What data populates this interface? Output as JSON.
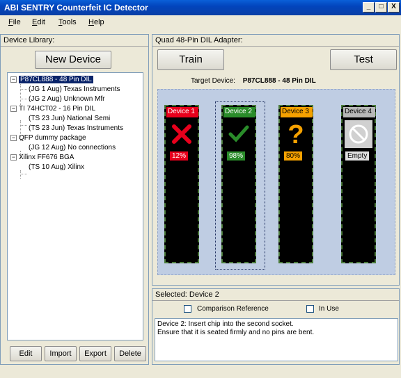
{
  "window": {
    "title": "ABI SENTRY Counterfeit IC Detector",
    "buttons": [
      "_",
      "□",
      "X"
    ]
  },
  "menu": [
    {
      "label": "File",
      "accel": "F",
      "rest": "ile"
    },
    {
      "label": "Edit",
      "accel": "E",
      "rest": "dit"
    },
    {
      "label": "Tools",
      "accel": "T",
      "rest": "ools"
    },
    {
      "label": "Help",
      "accel": "H",
      "rest": "elp"
    }
  ],
  "library": {
    "header": "Device Library:",
    "new_device": "New Device",
    "tree": [
      {
        "label": "P87CL888 - 48 Pin DIL",
        "selected": true
      },
      {
        "label": "(JG 1 Aug) Texas Instruments"
      },
      {
        "label": "(JG 2 Aug) Unknown Mfr"
      },
      {
        "label": "TI 74HCT02 - 16 Pin DIL"
      },
      {
        "label": "(TS 23 Jun) National Semi"
      },
      {
        "label": "(TS 23 Jun) Texas Instruments"
      },
      {
        "label": "QFP dummy package"
      },
      {
        "label": "(JG 12 Aug) No connections"
      },
      {
        "label": "Xilinx FF676 BGA"
      },
      {
        "label": "(TS 10 Aug) Xilinx"
      }
    ],
    "buttons": {
      "edit": "Edit",
      "import": "Import",
      "export": "Export",
      "delete": "Delete"
    }
  },
  "adapter": {
    "header": "Quad 48-Pin DIL Adapter:",
    "train": "Train",
    "test": "Test",
    "target_label": "Target Device:",
    "target_value": "P87CL888 - 48 Pin DIL",
    "devices": [
      {
        "name": "Device 1",
        "status": "fail",
        "icon": "cross-icon",
        "result": "12%",
        "color": "#e8001c"
      },
      {
        "name": "Device 2",
        "status": "pass",
        "icon": "check-icon",
        "result": "98%",
        "color": "#2a8c2a"
      },
      {
        "name": "Device 3",
        "status": "unknown",
        "icon": "question-icon",
        "result": "80%",
        "color": "#f5a100"
      },
      {
        "name": "Device 4",
        "status": "empty",
        "icon": "no-entry-icon",
        "result": "Empty",
        "color": "#9a9a9a"
      }
    ]
  },
  "selected": {
    "header": "Selected: Device 2",
    "comparison_reference": "Comparison Reference",
    "in_use": "In Use",
    "description_line1": "Device 2: Insert chip into the second socket.",
    "description_line2": "Ensure that it is seated firmly and no pins are bent."
  }
}
